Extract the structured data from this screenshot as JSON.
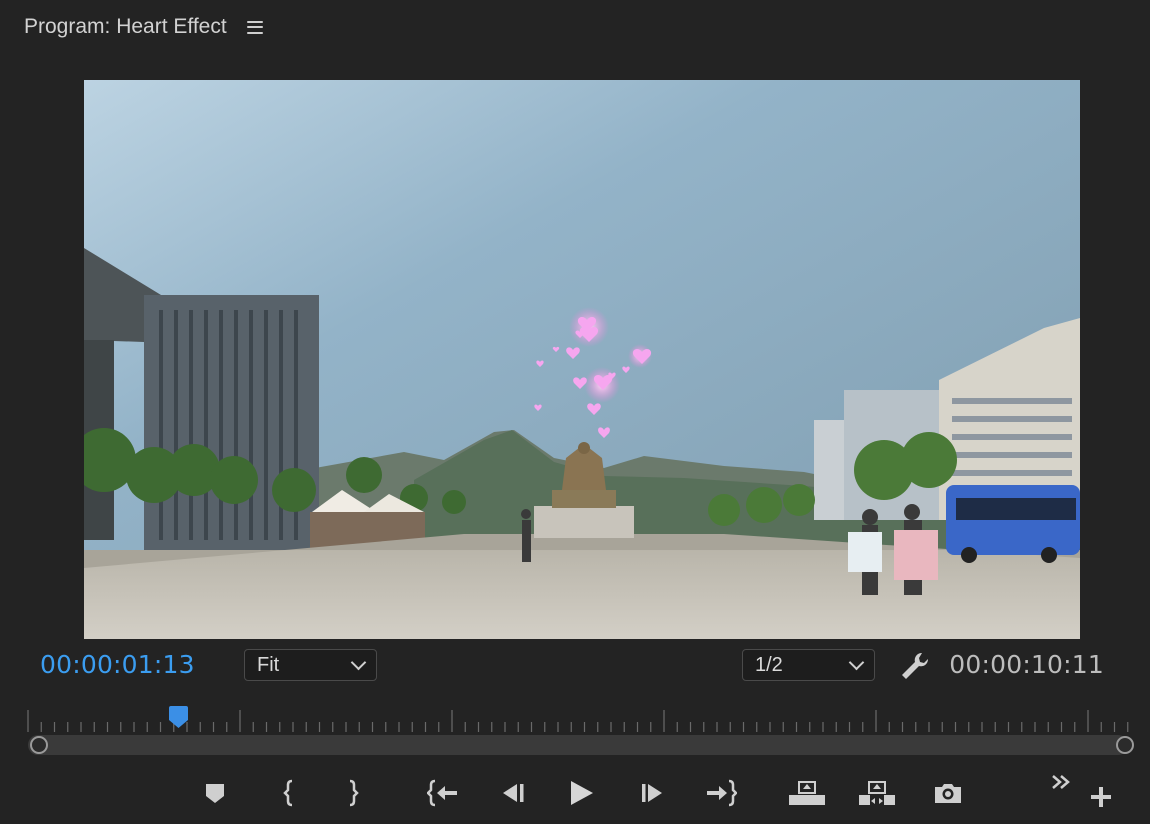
{
  "panel": {
    "title": "Program: Heart Effect",
    "menu_icon": "hamburger-icon"
  },
  "viewer": {
    "scene": "city-plaza-with-heart-particles"
  },
  "timecodes": {
    "current": "00:00:01:13",
    "duration": "00:00:10:11"
  },
  "zoom_dropdown": {
    "selected": "Fit"
  },
  "resolution_dropdown": {
    "selected": "1/2"
  },
  "playhead": {
    "position_fraction": 0.137
  },
  "colors": {
    "accent": "#3b9df0",
    "panel_bg": "#232323",
    "text": "#c8c8c8"
  },
  "transport_buttons": [
    "add-marker-icon",
    "mark-in-icon",
    "mark-out-icon",
    "go-to-in-icon",
    "step-back-icon",
    "play-icon",
    "step-forward-icon",
    "go-to-out-icon",
    "lift-icon",
    "extract-icon",
    "export-frame-icon",
    "more-controls-icon",
    "button-editor-icon"
  ]
}
